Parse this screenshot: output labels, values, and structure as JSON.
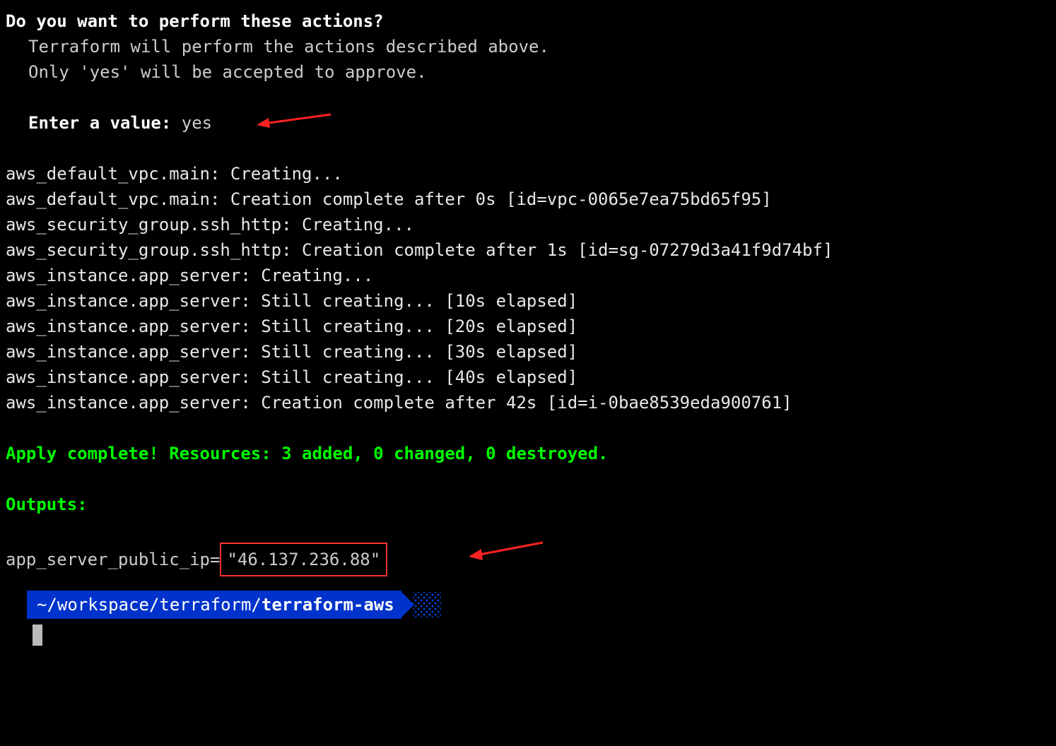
{
  "header": {
    "question": "Do you want to perform these actions?",
    "desc1": "Terraform will perform the actions described above.",
    "desc2": "Only 'yes' will be accepted to approve.",
    "enter_label": "Enter a value:",
    "enter_value": "yes"
  },
  "log_lines": [
    "aws_default_vpc.main: Creating...",
    "aws_default_vpc.main: Creation complete after 0s [id=vpc-0065e7ea75bd65f95]",
    "aws_security_group.ssh_http: Creating...",
    "aws_security_group.ssh_http: Creation complete after 1s [id=sg-07279d3a41f9d74bf]",
    "aws_instance.app_server: Creating...",
    "aws_instance.app_server: Still creating... [10s elapsed]",
    "aws_instance.app_server: Still creating... [20s elapsed]",
    "aws_instance.app_server: Still creating... [30s elapsed]",
    "aws_instance.app_server: Still creating... [40s elapsed]",
    "aws_instance.app_server: Creation complete after 42s [id=i-0bae8539eda900761]"
  ],
  "apply_complete": "Apply complete! Resources: 3 added, 0 changed, 0 destroyed.",
  "outputs_label": "Outputs:",
  "output": {
    "key": "app_server_public_ip",
    "equals": " = ",
    "value": "\"46.137.236.88\""
  },
  "prompt": {
    "path_prefix": "~/workspace/terraform/",
    "path_leaf": "terraform-aws"
  },
  "annotations": {
    "arrow1": "red-arrow-icon",
    "arrow2": "red-arrow-icon"
  }
}
